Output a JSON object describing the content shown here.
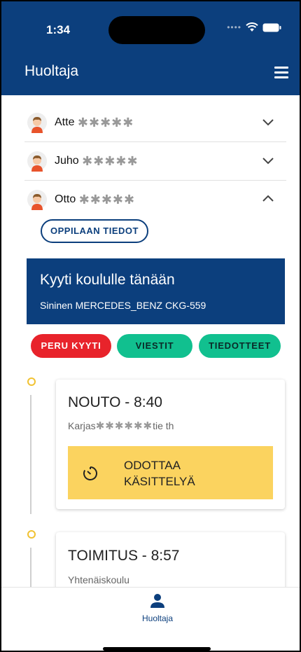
{
  "status_bar": {
    "time": "1:34"
  },
  "header": {
    "title": "Huoltaja"
  },
  "students": [
    {
      "first_name": "Atte",
      "masked": "✱✱✱✱✱",
      "expanded": false
    },
    {
      "first_name": "Juho",
      "masked": "✱✱✱✱✱",
      "expanded": false
    },
    {
      "first_name": "Otto",
      "masked": "✱✱✱✱✱",
      "expanded": true
    }
  ],
  "student_info_button": "OPPILAAN TIEDOT",
  "ride": {
    "title": "Kyyti koululle tänään",
    "vehicle": "Sininen MERCEDES_BENZ CKG-559"
  },
  "actions": {
    "cancel": "PERU KYYTI",
    "messages": "VIESTIT",
    "notices": "TIEDOTTEET"
  },
  "timeline": [
    {
      "title": "NOUTO - 8:40",
      "address_prefix": "Karjas",
      "address_masked": "✱✱✱✱✱✱",
      "address_suffix": "tie th",
      "status": "ODOTTAA KÄSITTELYÄ"
    },
    {
      "title": "TOIMITUS - 8:57",
      "address": "Yhtenäiskoulu"
    }
  ],
  "bottom_nav": {
    "label": "Huoltaja"
  },
  "colors": {
    "primary": "#0c3f7d",
    "danger": "#e8232b",
    "accent": "#11c08f",
    "warning": "#fbd35f",
    "timeline_dot": "#f1c232"
  }
}
